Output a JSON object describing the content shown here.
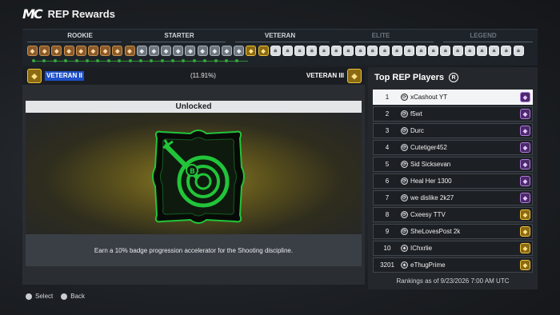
{
  "header": {
    "logo": "MC",
    "title": "REP Rewards"
  },
  "tiers": [
    {
      "label": "ROOKIE",
      "active": true
    },
    {
      "label": "STARTER",
      "active": true
    },
    {
      "label": "VETERAN",
      "active": true
    },
    {
      "label": "ELITE",
      "active": false
    },
    {
      "label": "LEGEND",
      "active": false
    }
  ],
  "rank": {
    "current": "VETERAN II",
    "percent_label": "(11.91%)",
    "next": "VETERAN III",
    "progress": 0.1191
  },
  "main": {
    "status": "Unlocked",
    "description": "Earn a 10% badge progression accelerator for the Shooting discipline."
  },
  "leaderboard": {
    "title": "Top REP Players",
    "title_button": "R",
    "rows": [
      {
        "rank": "1",
        "name": "xCashout YT",
        "badge": "purple"
      },
      {
        "rank": "2",
        "name": "f5wt",
        "badge": "purple"
      },
      {
        "rank": "3",
        "name": "Durc",
        "badge": "purple"
      },
      {
        "rank": "4",
        "name": "Cutetiger452",
        "badge": "purple"
      },
      {
        "rank": "5",
        "name": "Sid Sicksevan",
        "badge": "purple"
      },
      {
        "rank": "6",
        "name": "Heal Her 1300",
        "badge": "purple"
      },
      {
        "rank": "7",
        "name": "we dislike 2k27",
        "badge": "purple"
      },
      {
        "rank": "8",
        "name": "Cxeesy TTV",
        "badge": "gold"
      },
      {
        "rank": "9",
        "name": "SheLovesPost 2k",
        "badge": "gold"
      },
      {
        "rank": "10",
        "name": "IChxrlie",
        "badge": "gold"
      },
      {
        "rank": "3201",
        "name": "eThugPrime",
        "badge": "gold"
      }
    ],
    "rankings_note": "Rankings as of 9/23/2026 7:00 AM UTC"
  },
  "footer": {
    "select_label": "Select",
    "back_label": "Back"
  },
  "colors": {
    "accent_green": "#22c43a",
    "progress_blue": "#1f4fc7",
    "gold": "#f0c23a",
    "purple": "#b37ae0"
  }
}
